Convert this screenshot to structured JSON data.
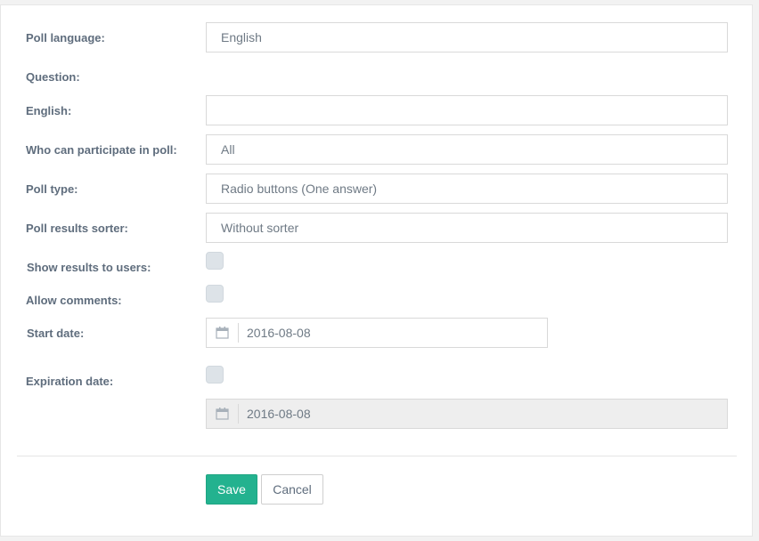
{
  "form": {
    "poll_language": {
      "label": "Poll language:",
      "value": "English"
    },
    "question": {
      "label": "Question:"
    },
    "english": {
      "label": "English:",
      "value": ""
    },
    "participants": {
      "label": "Who can participate in poll:",
      "value": "All"
    },
    "poll_type": {
      "label": "Poll type:",
      "value": "Radio buttons (One answer)"
    },
    "results_sorter": {
      "label": "Poll results sorter:",
      "value": "Without sorter"
    },
    "show_results": {
      "label": "Show results to users:",
      "checked": false
    },
    "allow_comments": {
      "label": "Allow comments:",
      "checked": false
    },
    "start_date": {
      "label": "Start date:",
      "value": "2016-08-08",
      "icon": "calendar-icon"
    },
    "expiration_date": {
      "label": "Expiration date:",
      "checked": false,
      "value": "2016-08-08",
      "disabled": true,
      "icon": "calendar-icon"
    }
  },
  "actions": {
    "save_label": "Save",
    "cancel_label": "Cancel"
  },
  "colors": {
    "primary": "#23b28f",
    "label_text": "#5f6d7d",
    "checkbox": "#dde3e8"
  }
}
